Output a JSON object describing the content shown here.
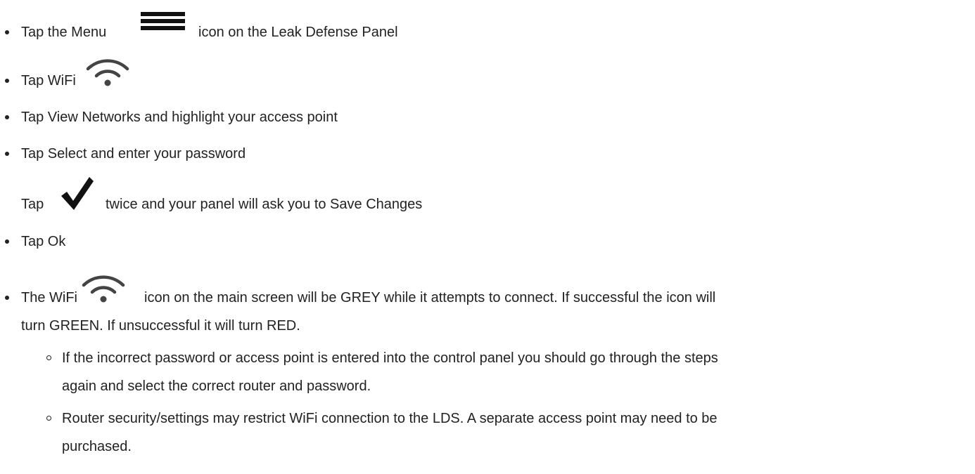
{
  "steps": [
    {
      "before": "Tap the Menu",
      "icon": "menu-icon",
      "after": "icon on the Leak Defense Panel"
    },
    {
      "before": "Tap WiFi",
      "icon": "wifi-icon"
    },
    {
      "text": "Tap View Networks and highlight your access point"
    },
    {
      "text": "Tap Select and enter your password"
    },
    {
      "before": "Tap",
      "icon": "checkmark-icon",
      "after": "twice and your panel will ask you to Save Changes"
    },
    {
      "text": "Tap Ok"
    },
    {
      "before": "The WiFi",
      "icon": "wifi-icon",
      "after": "icon on the main screen will be GREY while it attempts to connect. If successful the icon will",
      "line2": "turn GREEN. If unsuccessful it will turn RED.",
      "substeps": [
        {
          "line1": "If the incorrect password or access point is entered into the control panel you should go through the steps",
          "line2": "again and select the correct router and password."
        },
        {
          "line1": "Router security/settings may restrict WiFi connection to the LDS. A separate access point may need to be",
          "line2": "purchased."
        }
      ]
    }
  ],
  "colors": {
    "text": "#222222",
    "icon": "#111111"
  }
}
